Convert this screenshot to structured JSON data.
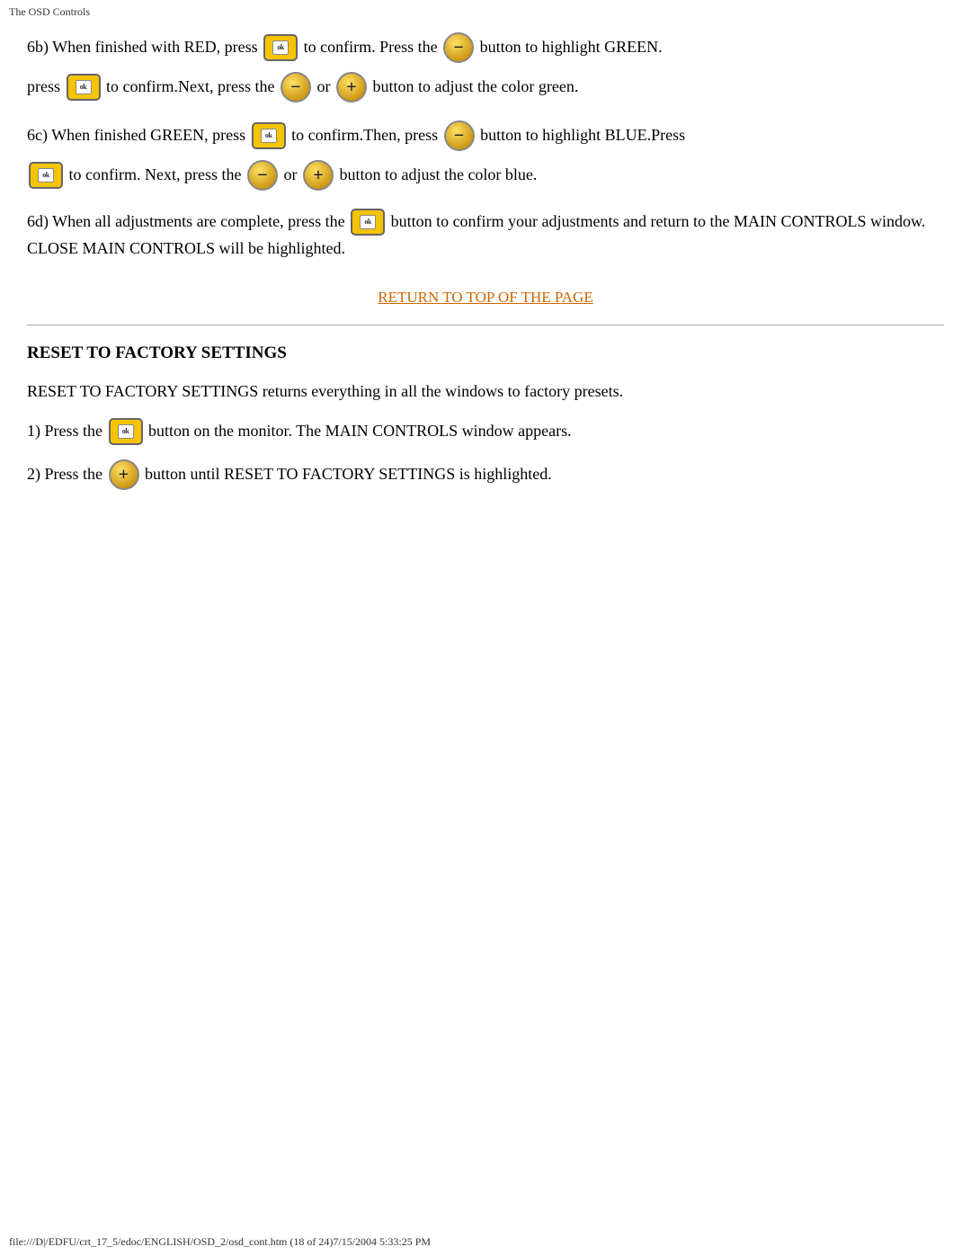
{
  "title_bar": "The OSD Controls",
  "status_bar": "file:///D|/EDFU/crt_17_5/edoc/ENGLISH/OSD_2/osd_cont.htm (18 of 24)7/15/2004 5:33:25 PM",
  "return_link": "RETURN TO TOP OF THE PAGE",
  "section_6b": {
    "line1_pre": "6b) When finished with RED, press",
    "line1_mid": "to confirm. Press the",
    "line1_post": "button to highlight GREEN.",
    "line2_pre": "press",
    "line2_mid": "to confirm.Next, press the",
    "line2_or": "or",
    "line2_post": "button to adjust the color green."
  },
  "section_6c": {
    "line1_pre": "6c) When finished GREEN, press",
    "line1_mid": "to confirm.Then, press",
    "line1_post": "button to highlight BLUE.Press",
    "line2_pre": "to confirm. Next, press the",
    "line2_or": "or",
    "line2_post": "button to adjust the color blue."
  },
  "section_6d": {
    "text_pre": "6d) When all adjustments are complete, press the",
    "text_mid": "button to confirm your adjustments and return to the MAIN CONTROLS window. CLOSE MAIN CONTROLS will be highlighted."
  },
  "reset_section": {
    "title": "RESET TO FACTORY SETTINGS",
    "intro": "RESET TO FACTORY SETTINGS returns everything in all the windows to factory presets.",
    "step1_pre": "1) Press the",
    "step1_post": "button on the monitor. The MAIN CONTROLS window appears.",
    "step2_pre": "2) Press the",
    "step2_post": "button until RESET TO FACTORY SETTINGS is highlighted."
  },
  "icons": {
    "ok_label": "ok",
    "minus_label": "−",
    "plus_label": "+"
  }
}
